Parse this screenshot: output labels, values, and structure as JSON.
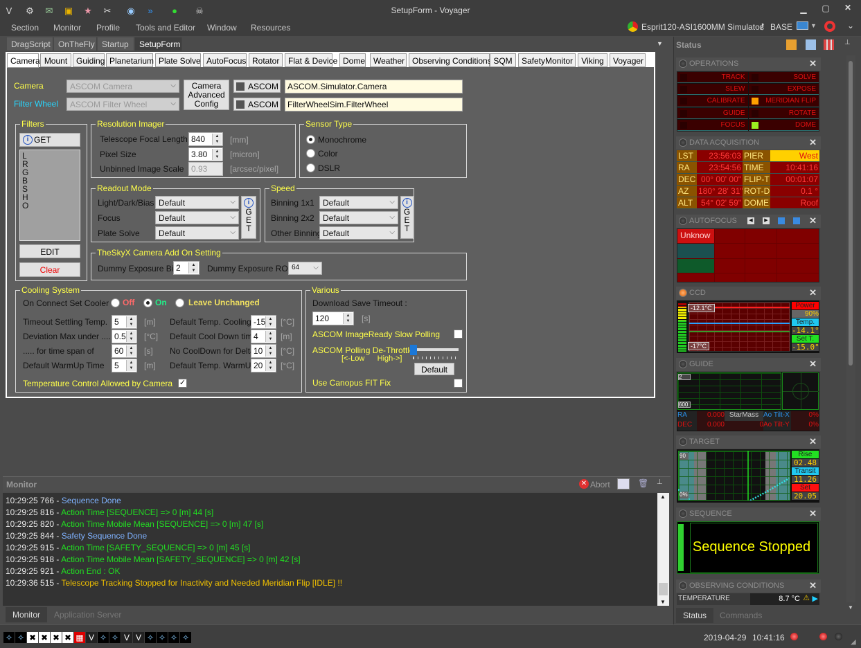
{
  "window": {
    "title": "SetupForm - Voyager",
    "toolbar_icons": [
      "voyager-logo-icon",
      "gear-icon",
      "inbox-icon",
      "folder-icon",
      "star-icon",
      "tools-icon",
      "eye-icon",
      "fast-forward-icon",
      "green-light-icon",
      "skull-icon"
    ]
  },
  "menu": [
    "Section",
    "Monitor",
    "Profile",
    "Tools and Editor",
    "Window",
    "Resources"
  ],
  "profile": {
    "name": "Esprit120-ASI1600MM Simulator",
    "mode": "BASE"
  },
  "doc_tabs": [
    "DragScript",
    "OnTheFly",
    "Startup",
    "SetupForm"
  ],
  "doc_tab_active": "SetupForm",
  "setup_tabs": [
    "Camera",
    "Mount",
    "Guiding",
    "Planetarium",
    "Plate Solve",
    "AutoFocus",
    "Rotator",
    "Flat & Device",
    "Dome",
    "Weather",
    "Observing Conditions",
    "SQM",
    "SafetyMonitor",
    "Viking",
    "Voyager"
  ],
  "setup_tab_active": "Camera",
  "camera": {
    "label": "Camera",
    "select": "ASCOM Camera",
    "advanced_config": "Camera Advanced Config",
    "ascom_label": "ASCOM",
    "driver": "ASCOM.Simulator.Camera"
  },
  "filter_wheel": {
    "label": "Filter Wheel",
    "select": "ASCOM Filter Wheel",
    "ascom_label": "ASCOM",
    "driver": "FilterWheelSim.FilterWheel"
  },
  "filters": {
    "title": "Filters",
    "get_label": "GET",
    "items": [
      "L",
      "R",
      "G",
      "B",
      "S",
      "H",
      "O"
    ],
    "edit_label": "EDIT",
    "clear_label": "Clear"
  },
  "resolution": {
    "title": "Resolution Imager",
    "rows": [
      {
        "label": "Telescope Focal Length",
        "value": "840",
        "unit": "[mm]"
      },
      {
        "label": "Pixel Size",
        "value": "3.80",
        "unit": "[micron]"
      },
      {
        "label": "Unbinned Image Scale",
        "value": "0.93",
        "unit": "[arcsec/pixel]"
      }
    ]
  },
  "sensor": {
    "title": "Sensor Type",
    "options": [
      "Monochrome",
      "Color",
      "DSLR"
    ],
    "selected": "Monochrome"
  },
  "readout": {
    "title": "Readout Mode",
    "rows": [
      {
        "label": "Light/Dark/Bias",
        "value": "Default"
      },
      {
        "label": "Focus",
        "value": "Default"
      },
      {
        "label": "Plate Solve",
        "value": "Default"
      }
    ],
    "get_letters": [
      "G",
      "E",
      "T"
    ]
  },
  "speed": {
    "title": "Speed",
    "rows": [
      {
        "label": "Binning 1x1",
        "value": "Default"
      },
      {
        "label": "Binning 2x2",
        "value": "Default"
      },
      {
        "label": "Other Binning",
        "value": "Default"
      }
    ],
    "get_letters": [
      "G",
      "E",
      "T"
    ]
  },
  "skyx": {
    "title": "TheSkyX Camera Add On Setting",
    "bin_label": "Dummy Exposure Bin",
    "bin_value": "2",
    "roi_label": "Dummy Exposure ROI",
    "roi_value": "64"
  },
  "cooling": {
    "title": "Cooling System",
    "connect_label": "On Connect Set Cooler",
    "options": [
      "Off",
      "On",
      "Leave Unchanged"
    ],
    "selected": "On",
    "left": [
      {
        "label": "Timeout Settling Temp.",
        "value": "5",
        "unit": "[m]"
      },
      {
        "label": "Deviation Max under ....",
        "value": "0.5",
        "unit": "[°C]"
      },
      {
        "label": "..... for time span of",
        "value": "60",
        "unit": "[s]"
      },
      {
        "label": "Default WarmUp Time",
        "value": "5",
        "unit": "[m]"
      }
    ],
    "right": [
      {
        "label": "Default Temp. Cooling",
        "value": "-15",
        "unit": "[°C]"
      },
      {
        "label": "Default Cool Down time",
        "value": "4",
        "unit": "[m]"
      },
      {
        "label": "No CoolDown for Delta",
        "value": "10",
        "unit": "[°C]"
      },
      {
        "label": "Default Temp. WarmUp",
        "value": "20",
        "unit": "[°C]"
      }
    ],
    "temp_control_label": "Temperature Control Allowed by Camera",
    "temp_control_checked": true
  },
  "various": {
    "title": "Various",
    "download_label": "Download  Save Timeout :",
    "download_value": "120",
    "download_unit": "[s]",
    "imageready_label": "ASCOM ImageReady Slow Polling",
    "imageready_checked": false,
    "dethrottle_label": "ASCOM Polling De-Throttle",
    "dethrottle_range": "[<-Low      High->]",
    "dethrottle_level": 0,
    "default_label": "Default",
    "canopus_label": "Use Canopus FIT Fix",
    "canopus_checked": false
  },
  "monitor": {
    "title": "Monitor",
    "abort_label": "Abort",
    "lines": [
      {
        "time": "10:29:25 766 - ",
        "text": "Sequence Done",
        "color": "#7fb2ff"
      },
      {
        "time": "10:29:25 816 - ",
        "text": "Action Time [SEQUENCE] => 0 [m] 44 [s]",
        "color": "#22dd22"
      },
      {
        "time": "10:29:25 820 - ",
        "text": "Action Time Mobile Mean [SEQUENCE] => 0 [m] 47 [s]",
        "color": "#22dd22"
      },
      {
        "time": "10:29:25 844 - ",
        "text": "Safety Sequence Done",
        "color": "#7fb2ff"
      },
      {
        "time": "10:29:25 915 - ",
        "text": "Action Time [SAFETY_SEQUENCE] => 0 [m] 45 [s]",
        "color": "#22dd22"
      },
      {
        "time": "10:29:25 918 - ",
        "text": "Action Time Mobile Mean [SAFETY_SEQUENCE] => 0 [m] 42 [s]",
        "color": "#22dd22"
      },
      {
        "time": "10:29:25 921 - ",
        "text": "Action End : OK",
        "color": "#22dd22"
      },
      {
        "time": "10:29:36 515 - ",
        "text": "Telescope Tracking Stopped for Inactivity and Needed Meridian Flip [IDLE] !!",
        "color": "#f0c000"
      }
    ]
  },
  "bottom_tabs": [
    "Monitor",
    "Application Server"
  ],
  "status_panel": {
    "title": "Status",
    "operations": {
      "title": "OPERATIONS",
      "items": [
        {
          "label": "TRACK",
          "led": "#2a0000"
        },
        {
          "label": "SOLVE",
          "led": "#2a0000"
        },
        {
          "label": "SLEW",
          "led": "#2a0000"
        },
        {
          "label": "EXPOSE",
          "led": "#2a0000"
        },
        {
          "label": "CALIBRATE",
          "led": "#2a0000"
        },
        {
          "label": "MERIDIAN FLIP",
          "led": "#ffa000"
        },
        {
          "label": "GUIDE",
          "led": "#2a0000"
        },
        {
          "label": "ROTATE",
          "led": "#2a0000"
        },
        {
          "label": "FOCUS",
          "led": "#2a0000"
        },
        {
          "label": "DOME",
          "led": "#9cf020"
        }
      ]
    },
    "data_acquisition": {
      "title": "DATA ACQUISITION",
      "rows": [
        [
          "LST",
          "23:56:03",
          "PIER",
          "West"
        ],
        [
          "RA",
          "23:54:56",
          "TIME",
          "10:41:16"
        ],
        [
          "DEC",
          "00° 00' 00\"",
          "FLIP-T",
          "00:01:07"
        ],
        [
          "AZ",
          "180° 28' 31\"",
          "ROT-D",
          "0.1 °"
        ],
        [
          "ALT",
          "54° 02' 59\"",
          "DOME",
          "Roof"
        ]
      ]
    },
    "autofocus": {
      "title": "AUTOFOCUS",
      "status": "Unknow"
    },
    "ccd": {
      "title": "CCD",
      "top_temp": "-12.1°C",
      "bottom_temp": "-17°C",
      "power_label": "Power",
      "power_value": "90%",
      "power": 90,
      "temp_label": "Temp.",
      "temp_value": "-14.1°",
      "set_label": "Set T.",
      "set_value": "-15.0°"
    },
    "guide": {
      "title": "GUIDE",
      "scale_top": "2",
      "scale_bottom": "600",
      "ra_label": "RA",
      "ra_value": "0.000",
      "dec_label": "DEC",
      "dec_value": "0.000",
      "starmass_label": "StarMass",
      "starmass_value": "0",
      "tiltx_label": "Ao Tilt-X",
      "tiltx_value": "0%",
      "tilty_label": "Ao Tilt-Y",
      "tilty_value": "0%"
    },
    "target": {
      "title": "TARGET",
      "scale_top": "90",
      "scale_bottom": "0%",
      "rise_label": "Rise",
      "rise_value": "02.48",
      "transit_label": "Transit",
      "transit_value": "11.26",
      "set_label": "Set",
      "set_value": "20.05"
    },
    "sequence": {
      "title": "SEQUENCE",
      "status": "Sequence Stopped"
    },
    "observing": {
      "title": "OBSERVING CONDITIONS",
      "row_label": "TEMPERATURE",
      "row_value": "8.7 °C"
    },
    "tabs": [
      "Status",
      "Commands"
    ]
  },
  "statusbar": {
    "date": "2019-04-29",
    "time": "10:41:16",
    "device_icons": [
      "star-chart",
      "star-chart",
      "disconnected",
      "disconnected",
      "disconnected",
      "disconnected",
      "error",
      "voyager",
      "star-chart",
      "star-chart",
      "voyager",
      "voyager",
      "star-chart",
      "star-chart",
      "star-chart",
      "star-chart"
    ]
  },
  "colors": {
    "label_yellow": "#ffff4a",
    "label_cyan": "#27d7ff",
    "driver_bg": "#fffbe0"
  }
}
